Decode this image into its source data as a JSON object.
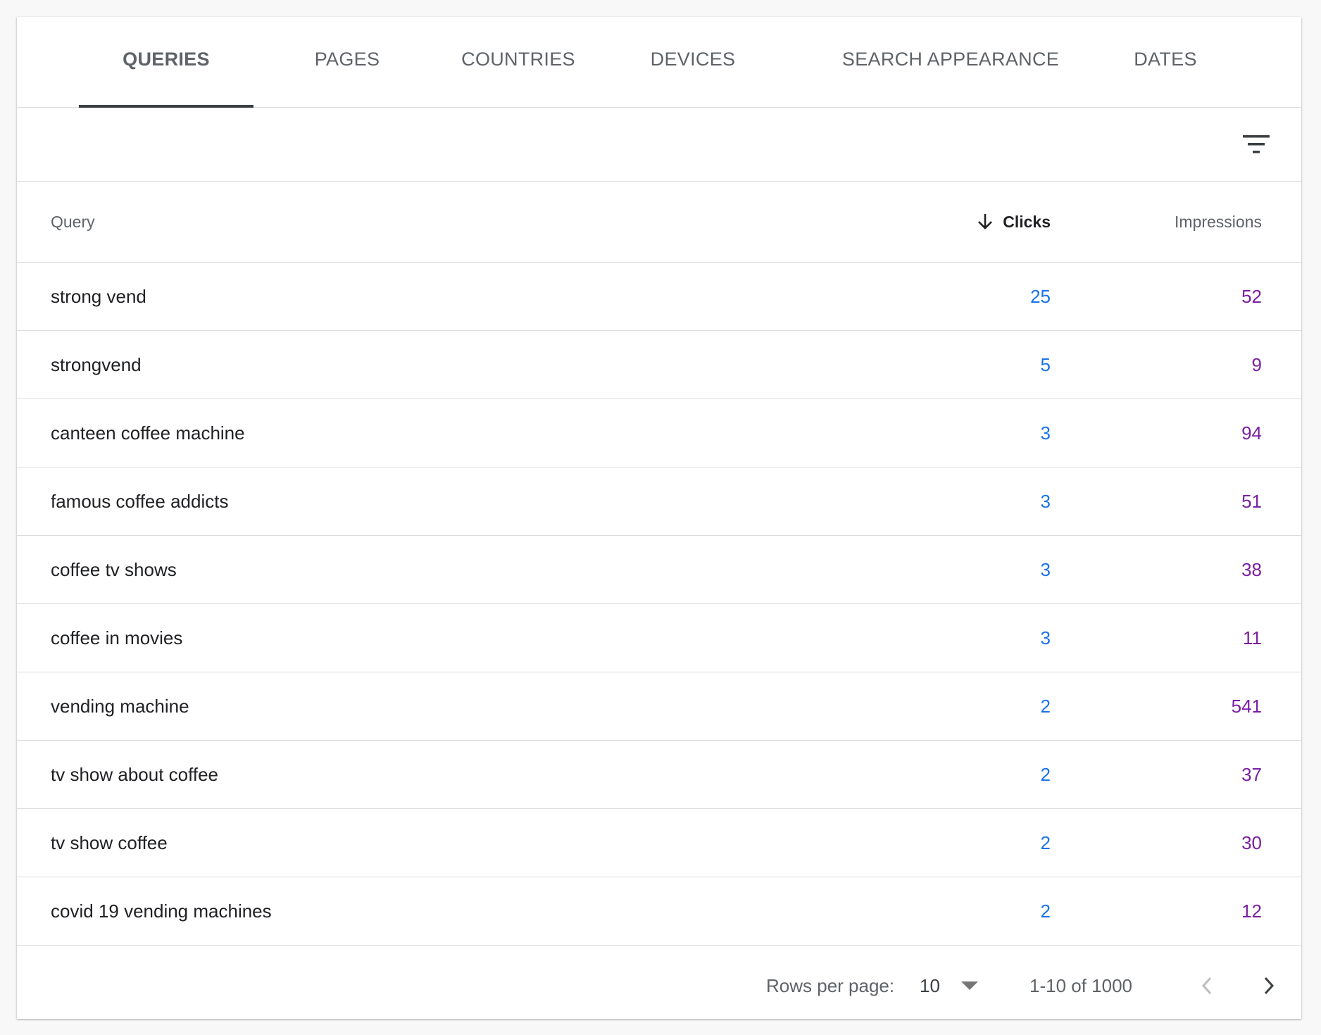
{
  "tabs": [
    {
      "label": "QUERIES",
      "active": true
    },
    {
      "label": "PAGES",
      "active": false
    },
    {
      "label": "COUNTRIES",
      "active": false
    },
    {
      "label": "DEVICES",
      "active": false
    },
    {
      "label": "SEARCH APPEARANCE",
      "active": false
    },
    {
      "label": "DATES",
      "active": false
    }
  ],
  "toolbar": {
    "filter_icon": "filter-list-icon"
  },
  "table": {
    "headers": {
      "query": "Query",
      "clicks": "Clicks",
      "impressions": "Impressions"
    },
    "sort": {
      "column": "clicks",
      "direction": "descending",
      "icon": "arrow-down-icon"
    },
    "rows": [
      {
        "query": "strong vend",
        "clicks": "25",
        "impressions": "52"
      },
      {
        "query": "strongvend",
        "clicks": "5",
        "impressions": "9"
      },
      {
        "query": "canteen coffee machine",
        "clicks": "3",
        "impressions": "94"
      },
      {
        "query": "famous coffee addicts",
        "clicks": "3",
        "impressions": "51"
      },
      {
        "query": "coffee tv shows",
        "clicks": "3",
        "impressions": "38"
      },
      {
        "query": "coffee in movies",
        "clicks": "3",
        "impressions": "11"
      },
      {
        "query": "vending machine",
        "clicks": "2",
        "impressions": "541"
      },
      {
        "query": "tv show about coffee",
        "clicks": "2",
        "impressions": "37"
      },
      {
        "query": "tv show coffee",
        "clicks": "2",
        "impressions": "30"
      },
      {
        "query": "covid 19 vending machines",
        "clicks": "2",
        "impressions": "12"
      }
    ]
  },
  "pagination": {
    "rows_per_page_label": "Rows per page:",
    "rows_per_page_value": "10",
    "range_text": "1-10 of 1000",
    "prev_icon": "chevron-left-icon",
    "next_icon": "chevron-right-icon"
  },
  "colors": {
    "clicks": "#1a73e8",
    "impressions": "#7b1fa2",
    "active_tab_indicator": "#3c4043"
  }
}
